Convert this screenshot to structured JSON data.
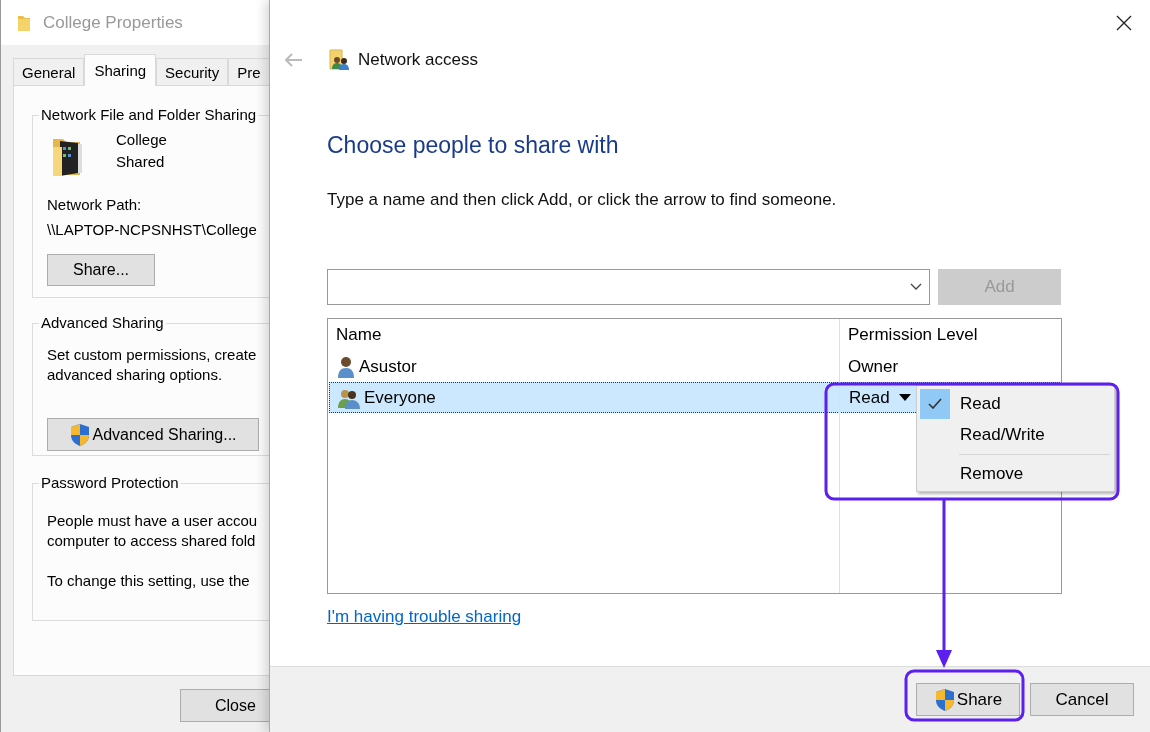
{
  "back_window": {
    "title": "College Properties",
    "tabs": [
      {
        "label": "General",
        "selected": false
      },
      {
        "label": "Sharing",
        "selected": true
      },
      {
        "label": "Security",
        "selected": false
      },
      {
        "label": "Pre",
        "selected": false
      }
    ],
    "network_sharing": {
      "heading": "Network File and Folder Sharing",
      "folder_name": "College",
      "folder_state": "Shared",
      "path_label": "Network Path:",
      "path": "\\\\LAPTOP-NCPSNHST\\College",
      "button": "Share..."
    },
    "advanced_sharing": {
      "heading": "Advanced Sharing",
      "lines": [
        "Set custom permissions, create",
        "advanced sharing options."
      ],
      "button": "Advanced Sharing..."
    },
    "password_protection": {
      "heading": "Password Protection",
      "lines": [
        "People must have a user accou",
        "computer to access shared fold"
      ],
      "note": "To change this setting, use the"
    },
    "close_button": "Close"
  },
  "dialog": {
    "nav_title": "Network access",
    "heading": "Choose people to share with",
    "instruction": "Type a name and then click Add, or click the arrow to find someone.",
    "add_button": {
      "label": "Add",
      "disabled": true
    },
    "columns": [
      "Name",
      "Permission Level"
    ],
    "rows": [
      {
        "name": "Asustor",
        "kind": "user",
        "permission": "Owner",
        "selected": false,
        "has_menu": false
      },
      {
        "name": "Everyone",
        "kind": "group",
        "permission": "Read",
        "selected": true,
        "has_menu": true
      }
    ],
    "menu": [
      {
        "label": "Read",
        "selected": true,
        "separator_before": false
      },
      {
        "label": "Read/Write",
        "selected": false,
        "separator_before": false
      },
      {
        "label": "Remove",
        "selected": false,
        "separator_before": true
      }
    ],
    "help_link": "I'm having trouble sharing",
    "share_button": {
      "label": "Share"
    },
    "cancel_button": "Cancel"
  },
  "annotation": {
    "color": "#5b1ff0"
  }
}
